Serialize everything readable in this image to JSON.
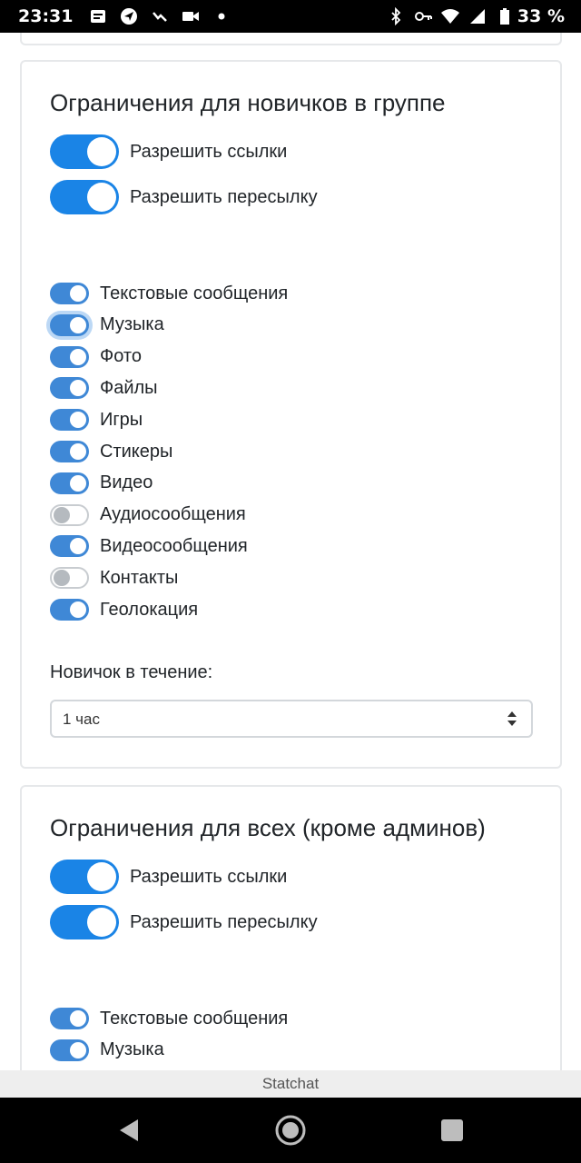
{
  "status_bar": {
    "time": "23:31",
    "battery": "33 %",
    "left_icons": [
      "notification-icon",
      "send-icon",
      "missed-call-icon",
      "video-icon",
      "dot-icon"
    ],
    "right_icons": [
      "bluetooth-icon",
      "key-icon",
      "wifi-icon",
      "signal-icon",
      "battery-icon"
    ]
  },
  "section_newbies": {
    "title": "Ограничения для новичков в группе",
    "allow_links": "Разрешить ссылки",
    "allow_forward": "Разрешить пересылку",
    "toggles": [
      {
        "label": "Текстовые сообщения",
        "on": true
      },
      {
        "label": "Музыка",
        "on": true
      },
      {
        "label": "Фото",
        "on": true
      },
      {
        "label": "Файлы",
        "on": true
      },
      {
        "label": "Игры",
        "on": true
      },
      {
        "label": "Стикеры",
        "on": true
      },
      {
        "label": "Видео",
        "on": true
      },
      {
        "label": "Аудиосообщения",
        "on": false
      },
      {
        "label": "Видеосообщения",
        "on": true
      },
      {
        "label": "Контакты",
        "on": false
      },
      {
        "label": "Геолокация",
        "on": true
      }
    ],
    "duration_label": "Новичок в течение:",
    "duration_value": "1 час"
  },
  "section_all": {
    "title": "Ограничения для всех (кроме админов)",
    "allow_links": "Разрешить ссылки",
    "allow_forward": "Разрешить пересылку",
    "toggles": [
      {
        "label": "Текстовые сообщения",
        "on": true
      },
      {
        "label": "Музыка",
        "on": true
      }
    ]
  },
  "footer": {
    "app_name": "Statchat"
  },
  "nav": {
    "icons": [
      "back-icon",
      "home-icon",
      "recents-icon"
    ]
  },
  "colors": {
    "accent": "#1a84e6",
    "switch_on": "#3f88d6",
    "switch_off_border": "#c8ccd0"
  }
}
